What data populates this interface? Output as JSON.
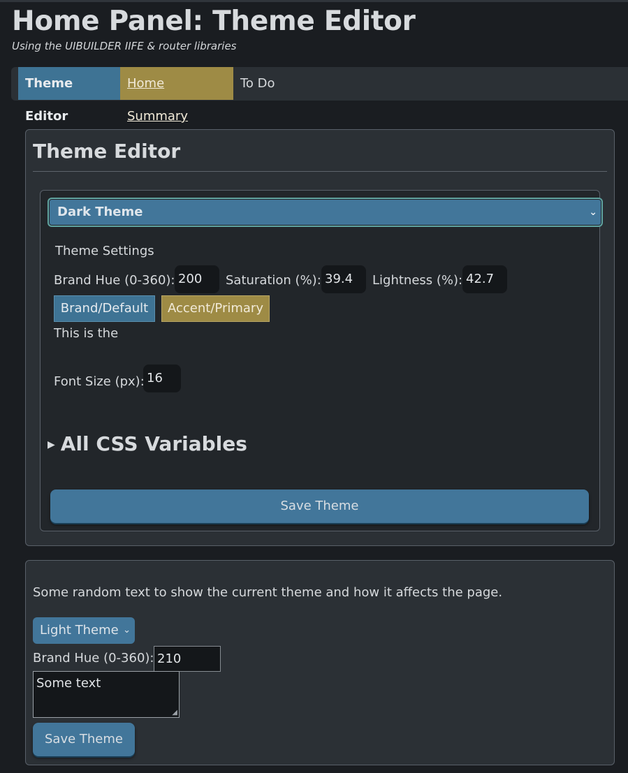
{
  "header": {
    "title": "Home Panel: Theme Editor",
    "subtitle": "Using the UIBUILDER IIFE & router libraries"
  },
  "nav": {
    "items": [
      {
        "label": "Theme Editor",
        "active": true
      },
      {
        "label": "Home Summary",
        "active": false
      },
      {
        "label": "To Do",
        "active": false
      }
    ]
  },
  "editor": {
    "title": "Theme Editor",
    "theme_select": {
      "selected": "Dark Theme"
    },
    "settings_label": "Theme Settings",
    "hue": {
      "label": "Brand Hue (0-360):",
      "value": "200"
    },
    "saturation": {
      "label": "Saturation (%):",
      "value": "39.4"
    },
    "lightness": {
      "label": "Lightness (%):",
      "value": "42.7"
    },
    "brand_button": "Brand/Default",
    "accent_button": "Accent/Primary",
    "note": "This is the",
    "font_size": {
      "label": "Font Size (px):",
      "value": "16"
    },
    "css_vars_summary": "All CSS Variables",
    "save_button": "Save Theme"
  },
  "demo": {
    "text": "Some random text to show the current theme and how it affects the page.",
    "select": {
      "selected": "Light Theme"
    },
    "hue": {
      "label": "Brand Hue (0-360):",
      "value": "210"
    },
    "textarea": "Some text",
    "save_button": "Save Theme"
  },
  "colors": {
    "brand": "#3e7394",
    "accent": "#9e8b45",
    "background": "#1a1d21",
    "card": "#2b3035"
  }
}
